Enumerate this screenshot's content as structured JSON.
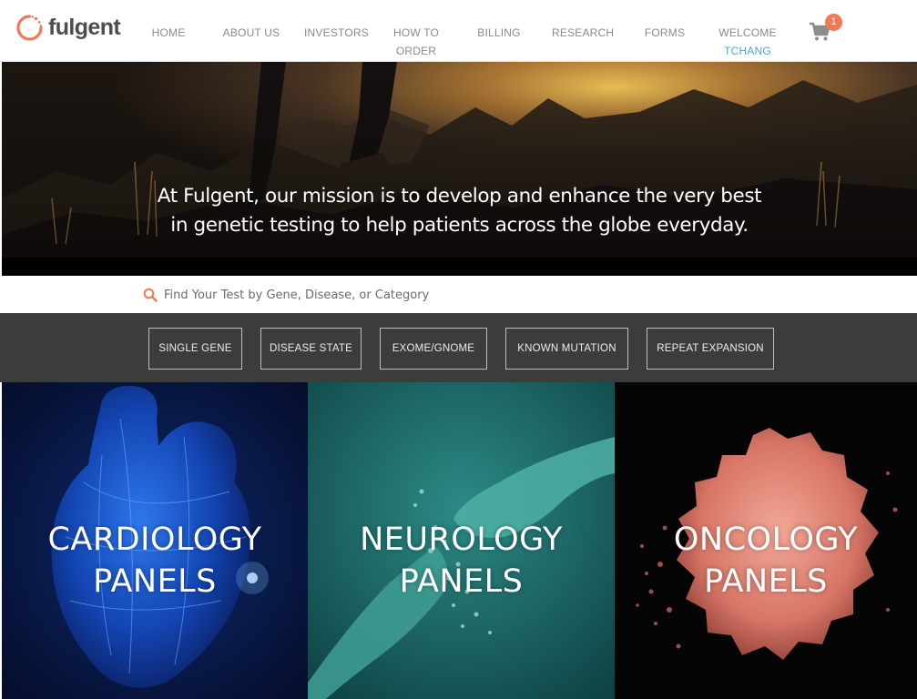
{
  "brand": {
    "name": "fulgent",
    "accent": "#f07a54",
    "link": "#4aa7d8"
  },
  "nav": {
    "items": [
      {
        "line1": "HOME",
        "line2": ""
      },
      {
        "line1": "ABOUT US",
        "line2": ""
      },
      {
        "line1": "INVESTORS",
        "line2": ""
      },
      {
        "line1": "HOW TO",
        "line2": "ORDER"
      },
      {
        "line1": "BILLING",
        "line2": ""
      },
      {
        "line1": "RESEARCH",
        "line2": ""
      },
      {
        "line1": "FORMS",
        "line2": ""
      },
      {
        "line1": "WELCOME",
        "line2": "TCHANG"
      }
    ],
    "cart_count": "1",
    "cart_icon": "shopping-cart-icon"
  },
  "hero": {
    "line1": "At Fulgent, our mission is to develop and enhance the very best",
    "line2": "in genetic testing to help patients across the globe everyday."
  },
  "search": {
    "placeholder": "Find Your Test by Gene, Disease, or Category",
    "icon": "search-icon"
  },
  "categories": [
    "SINGLE GENE",
    "DISEASE STATE",
    "EXOME/GNOME",
    "KNOWN MUTATION",
    "REPEAT EXPANSION"
  ],
  "panels": [
    {
      "line1": "CARDIOLOGY",
      "line2": "PANELS"
    },
    {
      "line1": "NEUROLOGY",
      "line2": "PANELS"
    },
    {
      "line1": "ONCOLOGY",
      "line2": "PANELS"
    }
  ]
}
